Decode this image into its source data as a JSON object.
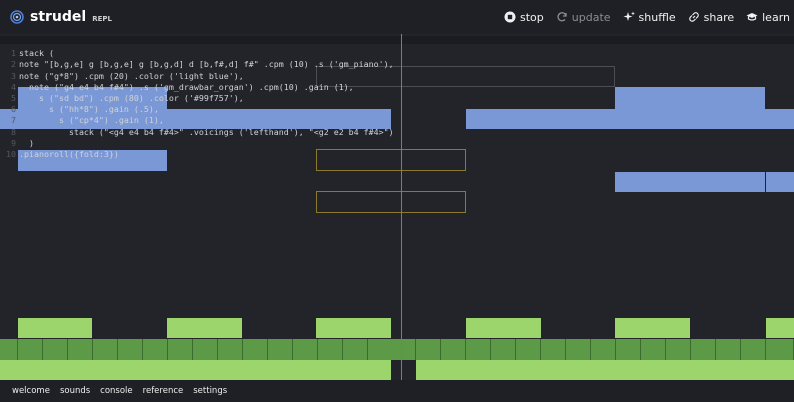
{
  "app": {
    "name": "strudel",
    "subtitle": "REPL"
  },
  "toolbar": {
    "stop": "stop",
    "update": "update",
    "shuffle": "shuffle",
    "share": "share",
    "learn": "learn"
  },
  "code": {
    "lines": [
      "stack (",
      "note \"[b,g,e] g [b,g,e] g [b,g,d] d [b,f#,d] f#\" .cpm (10) .s ('gm_piano'),",
      "note (\"g*8\") .cpm (20) .color ('light blue'),",
      "  note (\"g4 e4 b4 f#4\") .s ('gm_drawbar_organ') .cpm(10) .gain (1),",
      "    s (\"sd bd\") .cpm (80) .color ('#99f757'),",
      "      s (\"hh*8\") .gain (.5),",
      "        s (\"cp*4\") .gain (1),",
      "          stack (\"<g4 e4 b4 f#4>\" .voicings ('lefthand'), \"<g2 e2 b4 f#4>\")",
      "  )",
      ".pianoroll({fold:3})"
    ]
  },
  "footer": {
    "welcome": "welcome",
    "sounds": "sounds",
    "console": "console",
    "reference": "reference",
    "settings": "settings"
  },
  "colors": {
    "blue": "#7b98d6",
    "lime": "#9bd56b",
    "green": "#5c9a47"
  }
}
